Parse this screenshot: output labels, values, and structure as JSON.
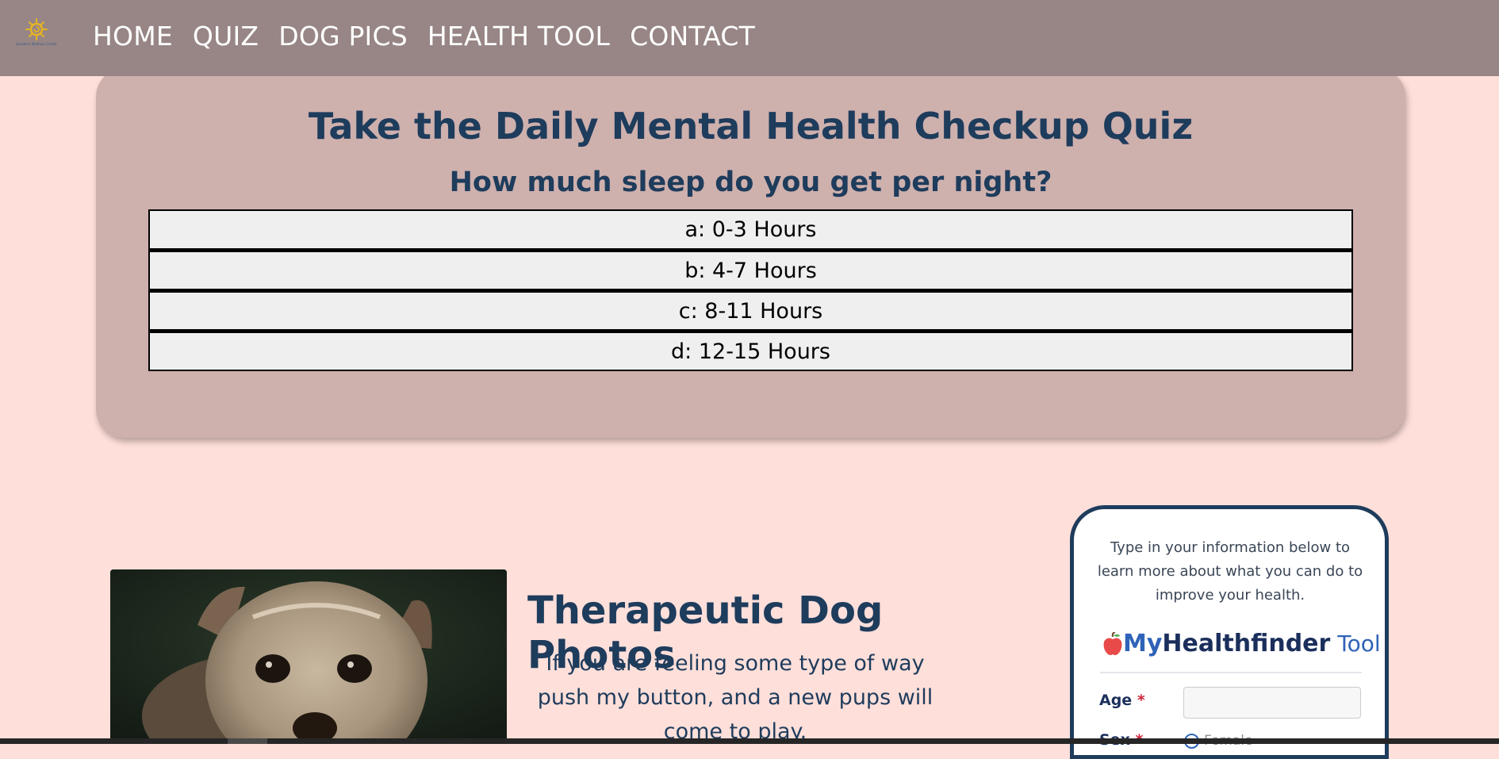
{
  "nav": {
    "logo_caption": "Sunshine Wellness Center",
    "links": [
      "HOME",
      "QUIZ",
      "DOG PICS",
      "HEALTH TOOL",
      "CONTACT"
    ]
  },
  "quiz": {
    "title": "Take the Daily Mental Health Checkup Quiz",
    "question": "How much sleep do you get per night?",
    "answers": [
      "a: 0-3 Hours",
      "b: 4-7 Hours",
      "c: 8-11 Hours",
      "d: 12-15 Hours"
    ]
  },
  "dogs": {
    "title": "Therapeutic Dog Photos",
    "description": "If you are feeling some type of way push my button, and a new pups will come to play."
  },
  "health_tool": {
    "intro": "Type in your information below to learn more about what you can do to improve your health.",
    "logo_my": "My",
    "logo_healthfinder": "Healthfinder",
    "logo_tool": "Tool",
    "age_label": "Age",
    "sex_label": "Sex",
    "required_marker": "*",
    "age_value": "",
    "sex_option_female": "Female"
  },
  "colors": {
    "navbar": "#978685",
    "page_bg": "#ffdfda",
    "card_bg": "#ceb0ad",
    "heading": "#1e3c5c",
    "answer_bg": "#efefef"
  }
}
